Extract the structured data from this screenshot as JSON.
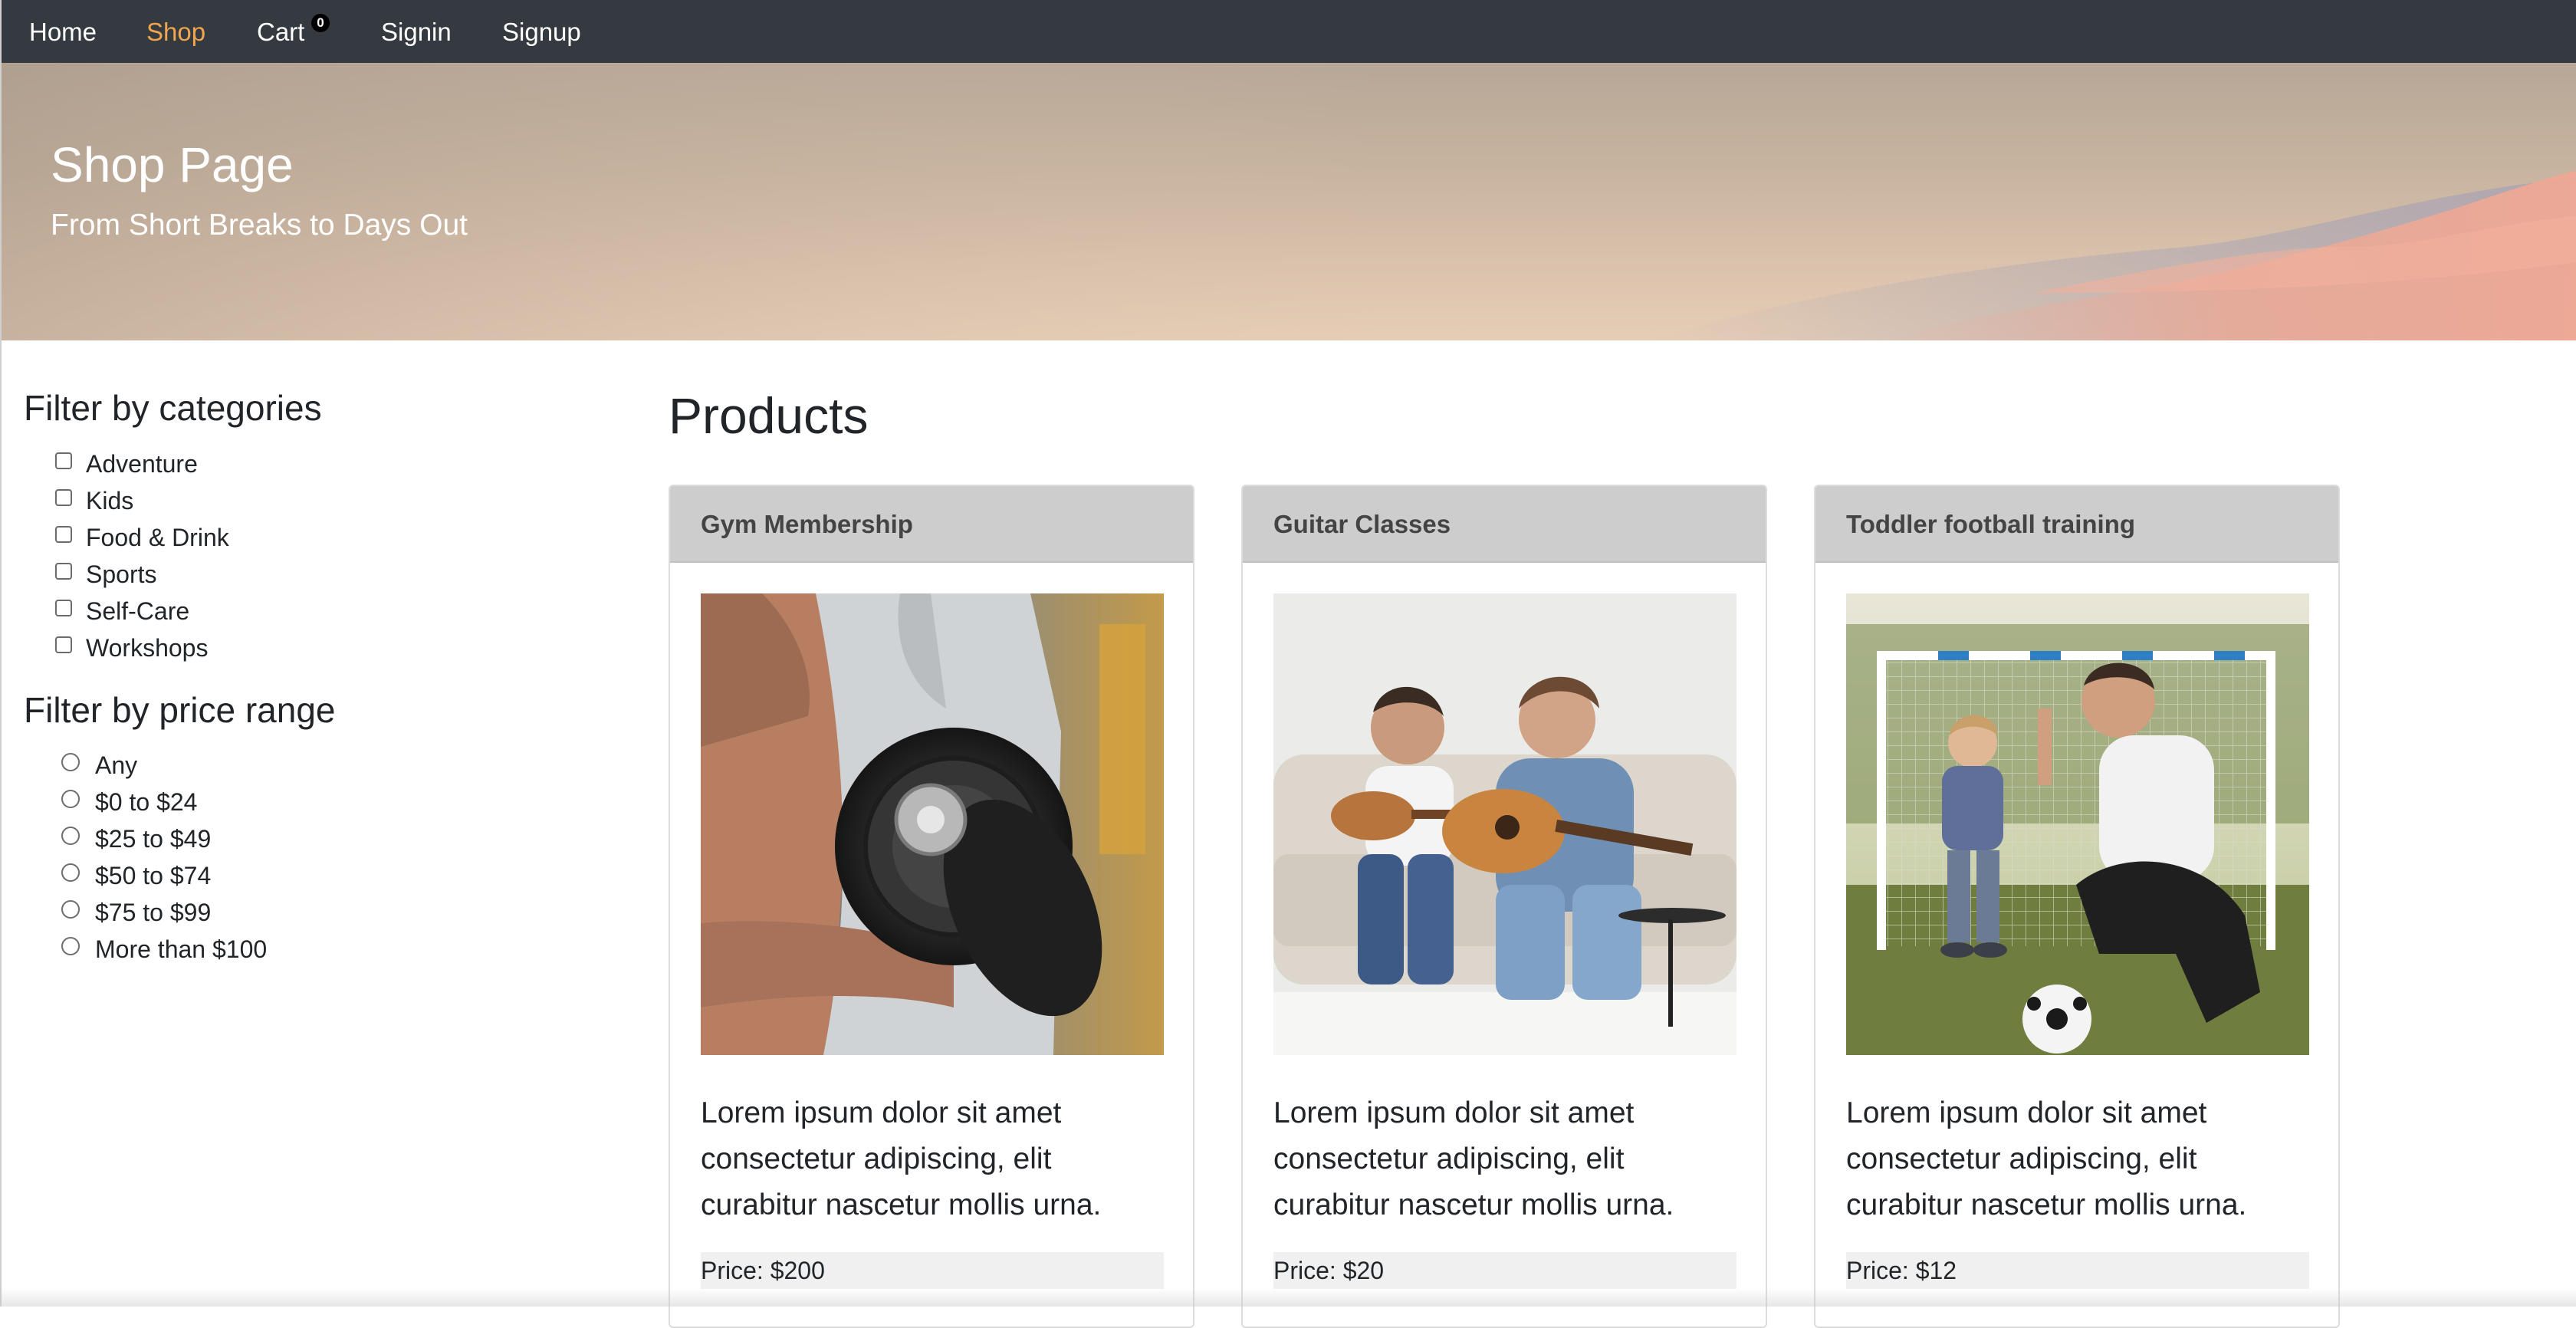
{
  "nav": {
    "home": "Home",
    "shop": "Shop",
    "cart": "Cart",
    "cart_count": "0",
    "signin": "Signin",
    "signup": "Signup",
    "active_color": "#f0a64f"
  },
  "hero": {
    "title": "Shop Page",
    "subtitle": "From Short Breaks to Days Out"
  },
  "filters": {
    "categories_heading": "Filter by categories",
    "categories": [
      "Adventure",
      "Kids",
      "Food & Drink",
      "Sports",
      "Self-Care",
      "Workshops"
    ],
    "price_heading": "Filter by price range",
    "price_ranges": [
      "Any",
      "$0 to $24",
      "$25 to $49",
      "$50 to $74",
      "$75 to $99",
      "More than $100"
    ]
  },
  "products": {
    "heading": "Products",
    "items": [
      {
        "title": "Gym Membership",
        "image": "dumbbell-photo",
        "description": "Lorem ipsum dolor sit amet consectetur adipiscing, elit curabitur nascetur mollis urna.",
        "price": "Price: $200"
      },
      {
        "title": "Guitar Classes",
        "image": "guitar-lesson-photo",
        "description": "Lorem ipsum dolor sit amet consectetur adipiscing, elit curabitur nascetur mollis urna.",
        "price": "Price: $20"
      },
      {
        "title": "Toddler football training",
        "image": "football-training-photo",
        "description": "Lorem ipsum dolor sit amet consectetur adipiscing, elit curabitur nascetur mollis urna.",
        "price": "Price: $12"
      }
    ]
  }
}
